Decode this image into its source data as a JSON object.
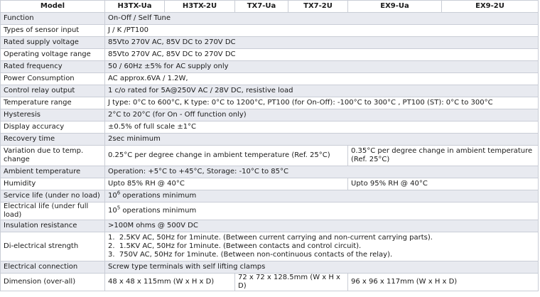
{
  "headers": [
    "Model",
    "H3TX-Ua",
    "H3TX-2U",
    "TX7-Ua",
    "TX7-2U",
    "EX9-Ua",
    "EX9-2U"
  ],
  "rows": {
    "function": {
      "label": "Function",
      "value": "On-Off / Self Tune"
    },
    "sensor": {
      "label": "Types of sensor input",
      "value": "J / K /PT100"
    },
    "supply": {
      "label": "Rated supply voltage",
      "value": "85Vto 270V AC, 85V DC to 270V DC"
    },
    "operating": {
      "label": "Operating voltage range",
      "value": "85Vto 270V AC, 85V DC to 270V DC"
    },
    "frequency": {
      "label": "Rated frequency",
      "value": "50 / 60Hz ±5% for AC supply only"
    },
    "power": {
      "label": "Power Consumption",
      "value": "AC approx.6VA / 1.2W,"
    },
    "relay": {
      "label": "Control relay output",
      "value": "1 c/o rated for 5A@250V AC / 28V DC, resistive load"
    },
    "temprange": {
      "label": "Temperature range",
      "value": "J type: 0°C to 600°C, K type: 0°C to 1200°C, PT100 (for On-Off): -100°C to 300°C , PT100 (ST): 0°C to 300°C"
    },
    "hysteresis": {
      "label": "Hysteresis",
      "value": "2°C to 20°C (for On - Off function only)"
    },
    "accuracy": {
      "label": "Display accuracy",
      "value": "±0.5% of full scale ±1°C"
    },
    "recovery": {
      "label": "Recovery time",
      "value": "2sec minimum"
    },
    "variation": {
      "label": "Variation due to temp. change",
      "value_a": "0.25°C per degree change in ambient temperature (Ref. 25°C)",
      "value_b": "0.35°C per degree change in ambient temperature (Ref. 25°C)"
    },
    "ambient": {
      "label": "Ambient temperature",
      "value": "Operation: +5°C to +45°C, Storage: -10°C to 85°C"
    },
    "humidity": {
      "label": "Humidity",
      "value_a": "Upto 85% RH @ 40°C",
      "value_b": "Upto 95% RH @ 40°C"
    },
    "service": {
      "label": "Service life (under no load)",
      "value": "10",
      "exp": "6",
      "suffix": " operations minimum"
    },
    "electrical": {
      "label": "Electrical life (under full load)",
      "value": "10",
      "exp": "5",
      "suffix": " operations minimum"
    },
    "insulation": {
      "label": "Insulation resistance",
      "value": ">100M ohms @ 500V DC"
    },
    "dielectric": {
      "label": "Di-electrical strength",
      "items": [
        "1.  2.5KV AC, 50Hz for 1minute. (Between current carrying and non-current carrying parts).",
        "2.  1.5KV AC, 50Hz for 1minute. (Between contacts and control circuit).",
        "3.  750V AC, 50Hz for 1minute. (Between non-continuous contacts of the relay)."
      ]
    },
    "connection": {
      "label": "Electrical connection",
      "value": "Screw type terminals with self lifting clamps"
    },
    "dimension": {
      "label": "Dimension (over-all)",
      "value_a": "48 x 48 x 115mm (W x H x D)",
      "value_b": "72 x 72 x 128.5mm (W x H x D)",
      "value_c": "96 x 96 x 117mm (W x H x D)"
    }
  }
}
